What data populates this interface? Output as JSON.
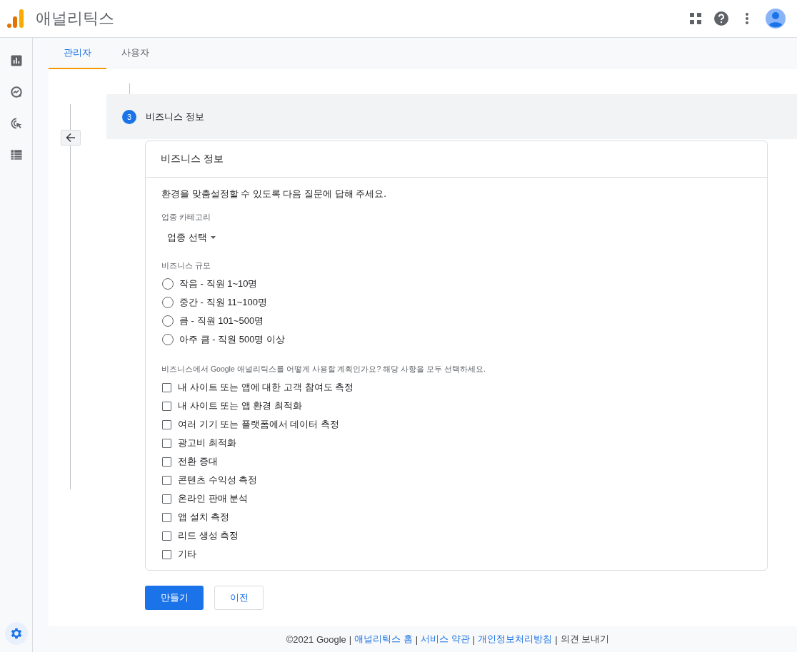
{
  "app": {
    "title": "애널리틱스"
  },
  "sidebar": {
    "items": [
      {
        "kind": "reports",
        "selected": false
      },
      {
        "kind": "explore",
        "selected": false
      },
      {
        "kind": "advertising",
        "selected": false
      },
      {
        "kind": "configure",
        "selected": false
      },
      {
        "kind": "admin",
        "selected": true
      }
    ]
  },
  "tabs": [
    {
      "label": "관리자",
      "selected": true
    },
    {
      "label": "사용자",
      "selected": false
    }
  ],
  "step": {
    "number": "3",
    "title": "비즈니스 정보"
  },
  "card": {
    "title": "비즈니스 정보",
    "intro": "환경을 맞춤설정할 수 있도록 다음 질문에 답해 주세요.",
    "industry": {
      "label": "업종 카테고리",
      "value": "업종 선택"
    },
    "size": {
      "label": "비즈니스 규모",
      "options": [
        {
          "label": "작음 - 직원 1~10명",
          "selected": false
        },
        {
          "label": "중간 - 직원 11~100명",
          "selected": false
        },
        {
          "label": "큼 - 직원 101~500명",
          "selected": false
        },
        {
          "label": "아주 큼 - 직원 500명 이상",
          "selected": false
        }
      ]
    },
    "usage": {
      "label": "비즈니스에서 Google 애널리틱스를 어떻게 사용할 계획인가요? 해당 사항을 모두 선택하세요.",
      "options": [
        {
          "label": "내 사이트 또는 앱에 대한 고객 참여도 측정",
          "checked": false
        },
        {
          "label": "내 사이트 또는 앱 환경 최적화",
          "checked": false
        },
        {
          "label": "여러 기기 또는 플랫폼에서 데이터 측정",
          "checked": false
        },
        {
          "label": "광고비 최적화",
          "checked": false
        },
        {
          "label": "전환 증대",
          "checked": false
        },
        {
          "label": "콘텐츠 수익성 측정",
          "checked": false
        },
        {
          "label": "온라인 판매 분석",
          "checked": false
        },
        {
          "label": "앱 설치 측정",
          "checked": false
        },
        {
          "label": "리드 생성 측정",
          "checked": false
        },
        {
          "label": "기타",
          "checked": false
        }
      ]
    }
  },
  "buttons": [
    {
      "label": "만들기",
      "kind": "primary"
    },
    {
      "label": "이전",
      "kind": "secondary"
    }
  ],
  "footer": {
    "items": [
      {
        "text": "©2021 Google",
        "kind": "text"
      },
      {
        "text": "|",
        "kind": "separator"
      },
      {
        "text": "애널리틱스 홈",
        "kind": "link"
      },
      {
        "text": "|",
        "kind": "separator"
      },
      {
        "text": "서비스 약관",
        "kind": "link"
      },
      {
        "text": "|",
        "kind": "separator"
      },
      {
        "text": "개인정보처리방침",
        "kind": "link"
      },
      {
        "text": "|",
        "kind": "separator"
      },
      {
        "text": "의견 보내기",
        "kind": "text"
      }
    ]
  }
}
